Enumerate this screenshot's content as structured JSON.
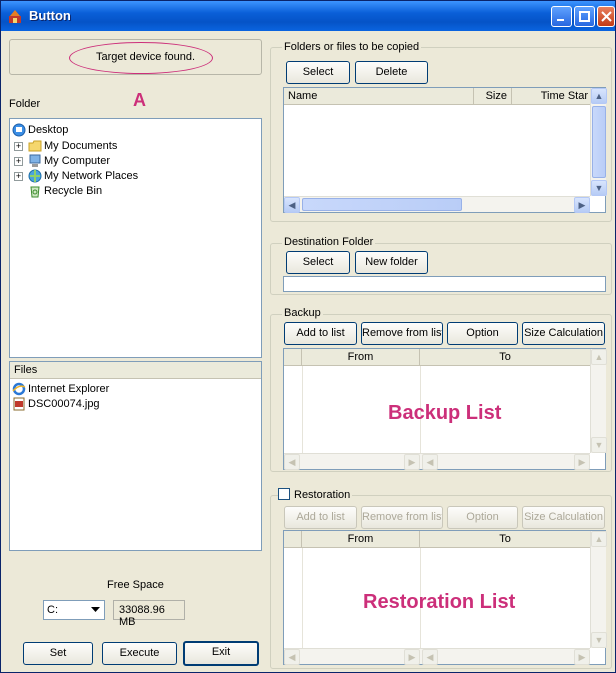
{
  "window": {
    "title": "Button"
  },
  "status": {
    "text": "Target device found."
  },
  "annotations": {
    "marker_a": "A",
    "backup_list": "Backup List",
    "restoration_list": "Restoration List"
  },
  "folder_tree": {
    "label": "Folder",
    "items": [
      {
        "label": "Desktop",
        "icon": "desktop-icon"
      },
      {
        "label": "My Documents",
        "icon": "folder-icon"
      },
      {
        "label": "My Computer",
        "icon": "computer-icon"
      },
      {
        "label": "My Network Places",
        "icon": "network-icon"
      },
      {
        "label": "Recycle Bin",
        "icon": "recycle-bin-icon"
      }
    ]
  },
  "files": {
    "header": "Files",
    "items": [
      {
        "label": "Internet Explorer",
        "icon": "internet-explorer-icon"
      },
      {
        "label": "DSC00074.jpg",
        "icon": "image-file-icon"
      }
    ]
  },
  "free_space": {
    "label": "Free Space",
    "drive": "C:",
    "value": "33088.96 MB"
  },
  "bottom_buttons": {
    "set": "Set",
    "execute": "Execute",
    "exit": "Exit"
  },
  "copy_group": {
    "label": "Folders or files to be copied",
    "select": "Select",
    "delete": "Delete",
    "columns": [
      "Name",
      "Size",
      "Time Star"
    ]
  },
  "destination": {
    "label": "Destination Folder",
    "select": "Select",
    "new_folder": "New folder",
    "path": ""
  },
  "backup": {
    "label": "Backup",
    "add": "Add to list",
    "remove": "Remove from list",
    "option": "Option",
    "size_calc": "Size Calculation",
    "columns": [
      "From",
      "To"
    ]
  },
  "restoration": {
    "label": "Restoration",
    "checked": false,
    "add": "Add to list",
    "remove": "Remove from list",
    "option": "Option",
    "size_calc": "Size Calculation",
    "columns": [
      "From",
      "To"
    ]
  },
  "colors": {
    "annotation": "#cc2f7a",
    "titlebar": "#0553c7",
    "window_bg": "#ece9d8"
  }
}
